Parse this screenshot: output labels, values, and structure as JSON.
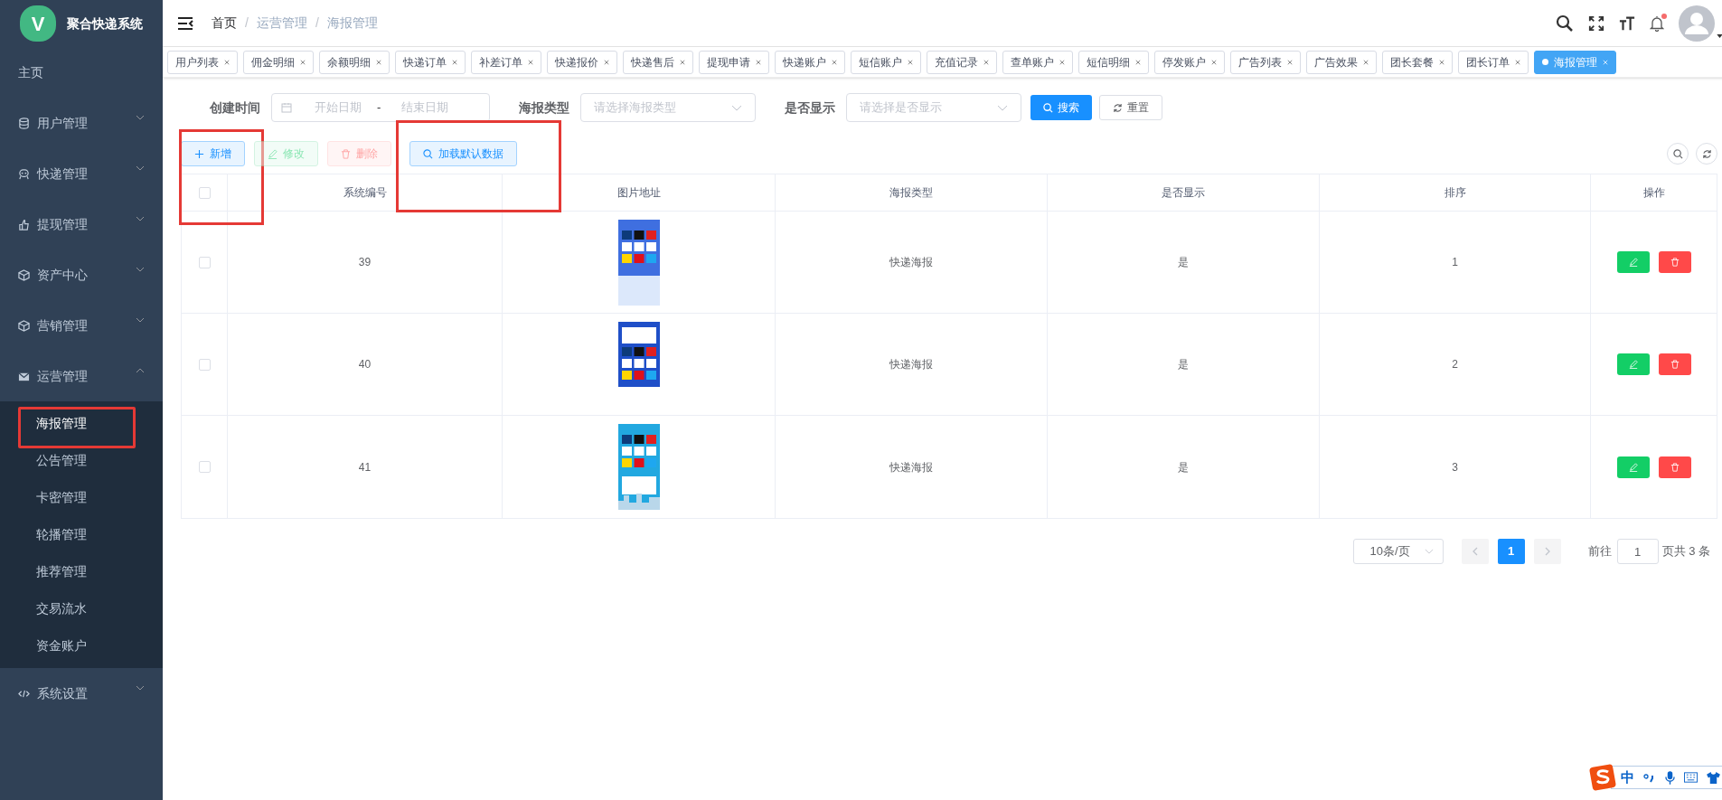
{
  "app": {
    "title": "聚合快递系统",
    "logo_letter": "V"
  },
  "sidebar": {
    "items": [
      {
        "label": "主页",
        "kind": "link"
      },
      {
        "label": "用户管理",
        "kind": "group",
        "expanded": false
      },
      {
        "label": "快递管理",
        "kind": "group",
        "expanded": false
      },
      {
        "label": "提现管理",
        "kind": "group",
        "expanded": false
      },
      {
        "label": "资产中心",
        "kind": "group",
        "expanded": false
      },
      {
        "label": "营销管理",
        "kind": "group",
        "expanded": false
      },
      {
        "label": "运营管理",
        "kind": "group",
        "expanded": true,
        "children": [
          {
            "label": "海报管理",
            "selected": true,
            "highlighted": true
          },
          {
            "label": "公告管理",
            "selected": false,
            "highlighted": false
          },
          {
            "label": "卡密管理",
            "selected": false,
            "highlighted": false
          },
          {
            "label": "轮播管理",
            "selected": false,
            "highlighted": false
          },
          {
            "label": "推荐管理",
            "selected": false,
            "highlighted": false
          },
          {
            "label": "交易流水",
            "selected": false,
            "highlighted": false
          },
          {
            "label": "资金账户",
            "selected": false,
            "highlighted": false
          }
        ]
      },
      {
        "label": "系统设置",
        "kind": "group",
        "expanded": false
      }
    ]
  },
  "breadcrumb": [
    "首页",
    "运营管理",
    "海报管理"
  ],
  "breadcrumb_separator": "/",
  "header": {
    "notification_dot": true
  },
  "tabs": [
    {
      "label": "用户列表",
      "selected": false
    },
    {
      "label": "佣金明细",
      "selected": false
    },
    {
      "label": "余额明细",
      "selected": false
    },
    {
      "label": "快递订单",
      "selected": false
    },
    {
      "label": "补差订单",
      "selected": false
    },
    {
      "label": "快递报价",
      "selected": false
    },
    {
      "label": "快递售后",
      "selected": false
    },
    {
      "label": "提现申请",
      "selected": false
    },
    {
      "label": "快递账户",
      "selected": false
    },
    {
      "label": "短信账户",
      "selected": false
    },
    {
      "label": "充值记录",
      "selected": false
    },
    {
      "label": "查单账户",
      "selected": false
    },
    {
      "label": "短信明细",
      "selected": false
    },
    {
      "label": "停发账户",
      "selected": false
    },
    {
      "label": "广告列表",
      "selected": false
    },
    {
      "label": "广告效果",
      "selected": false
    },
    {
      "label": "团长套餐",
      "selected": false
    },
    {
      "label": "团长订单",
      "selected": false
    },
    {
      "label": "海报管理",
      "selected": true
    }
  ],
  "filters": {
    "created_label": "创建时间",
    "start_placeholder": "开始日期",
    "range_separator": "-",
    "end_placeholder": "结束日期",
    "type_label": "海报类型",
    "type_placeholder": "请选择海报类型",
    "show_label": "是否显示",
    "show_placeholder": "请选择是否显示",
    "search_button": "搜索",
    "reset_button": "重置"
  },
  "toolbar": [
    {
      "label": "新增",
      "kind": "add",
      "disabled": false,
      "highlighted": true
    },
    {
      "label": "修改",
      "kind": "edit",
      "disabled": true,
      "highlighted": false
    },
    {
      "label": "删除",
      "kind": "delete",
      "disabled": true,
      "highlighted": false
    },
    {
      "label": "加载默认数据",
      "kind": "load",
      "disabled": false,
      "highlighted": true
    }
  ],
  "table": {
    "select_all_checked": false,
    "columns": [
      "系统编号",
      "图片地址",
      "海报类型",
      "是否显示",
      "排序",
      "操作"
    ],
    "rows": [
      {
        "checked": false,
        "id": "39",
        "type": "快递海报",
        "shown": "是",
        "sort": "1"
      },
      {
        "checked": false,
        "id": "40",
        "type": "快递海报",
        "shown": "是",
        "sort": "2"
      },
      {
        "checked": false,
        "id": "41",
        "type": "快递海报",
        "shown": "是",
        "sort": "3"
      }
    ]
  },
  "pagination": {
    "page_size": "10条/页",
    "pages": [
      {
        "label": "1",
        "selected": true
      }
    ],
    "goto_label": "前往",
    "goto_value": "1",
    "total": "页共 3 条"
  },
  "ime_bar": {
    "mode": "中"
  }
}
